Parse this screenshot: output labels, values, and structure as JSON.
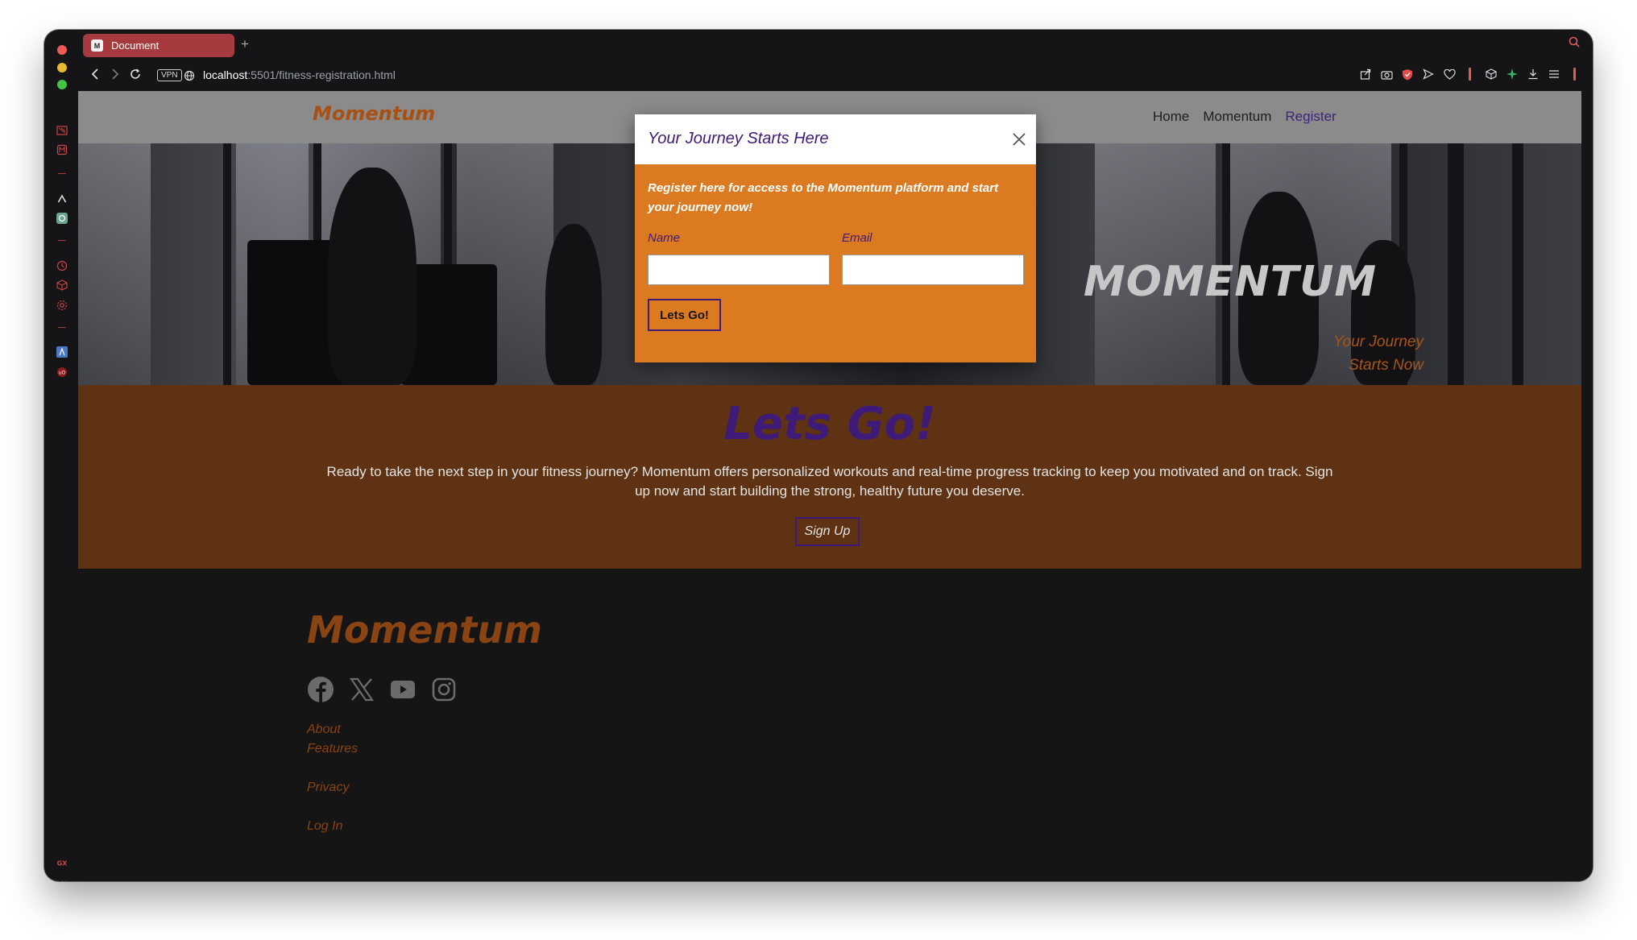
{
  "browser": {
    "tab_title": "Document",
    "tab_favicon": "M",
    "new_tab": "+",
    "vpn_badge": "VPN",
    "url_host": "localhost",
    "url_rest": ":5501/fitness-registration.html"
  },
  "site": {
    "brand": "Momentum",
    "nav": [
      {
        "label": "Home",
        "active": false
      },
      {
        "label": "Momentum",
        "active": false
      },
      {
        "label": "Register",
        "active": true
      }
    ],
    "hero": {
      "title": "MOMENTUM",
      "subtitle_line1": "Your Journey",
      "subtitle_line2": "Starts Now"
    },
    "cta": {
      "heading": "Lets Go!",
      "text": "Ready to take the next step in your fitness journey? Momentum offers personalized workouts and real-time progress tracking to keep you motivated and on track. Sign up now and start building the strong, healthy future you deserve.",
      "button": "Sign Up"
    },
    "footer": {
      "brand": "Momentum",
      "social_icons": [
        "facebook-icon",
        "x-icon",
        "youtube-icon",
        "instagram-icon"
      ],
      "links": [
        "About",
        "Features",
        "Privacy",
        "Log In"
      ]
    }
  },
  "modal": {
    "title": "Your Journey Starts Here",
    "description": "Register here for access to the Momentum platform and start your journey now!",
    "name_label": "Name",
    "email_label": "Email",
    "name_value": "",
    "email_value": "",
    "button": "Lets Go!"
  },
  "colors": {
    "brand_orange": "#a84f12",
    "modal_orange": "#dc7a21",
    "accent_purple": "#3e1b78",
    "section_brown": "#5e3212",
    "tab_red": "#a63a3e"
  }
}
